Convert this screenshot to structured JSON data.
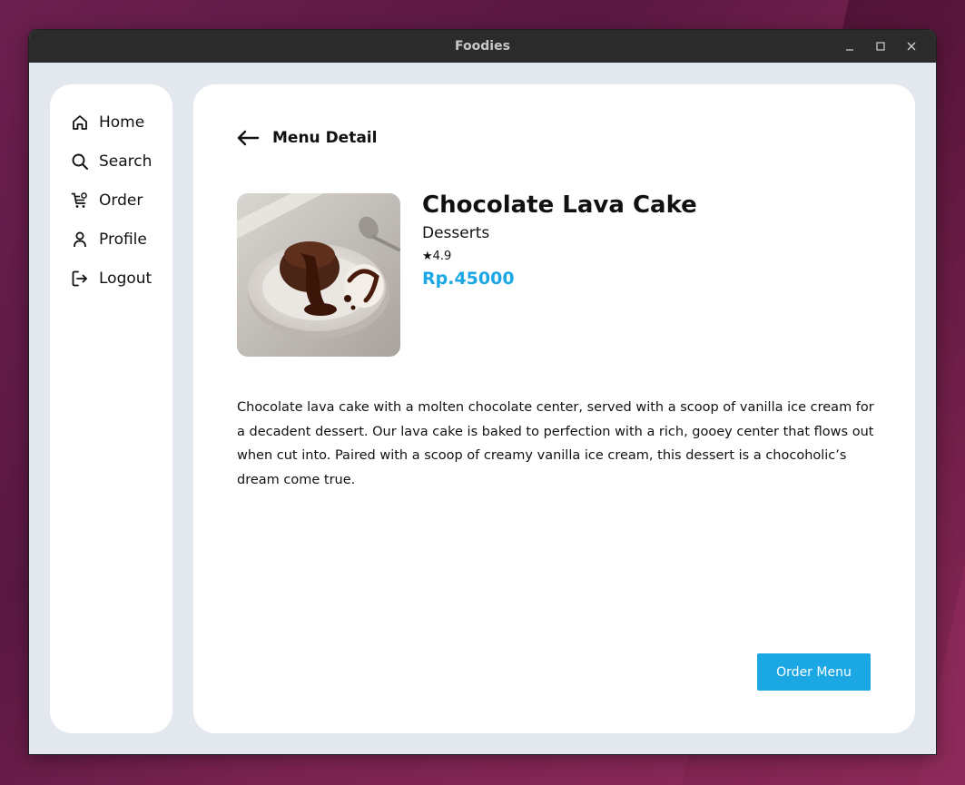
{
  "window": {
    "title": "Foodies"
  },
  "sidebar": {
    "items": [
      {
        "label": "Home",
        "icon": "home-icon"
      },
      {
        "label": "Search",
        "icon": "search-icon"
      },
      {
        "label": "Order",
        "icon": "cart-icon"
      },
      {
        "label": "Profile",
        "icon": "user-icon"
      },
      {
        "label": "Logout",
        "icon": "logout-icon"
      }
    ]
  },
  "main": {
    "title": "Menu Detail",
    "item": {
      "name": "Chocolate Lava Cake",
      "category": "Desserts",
      "rating": "★4.9",
      "price": "Rp.45000",
      "description": "Chocolate lava cake with a molten chocolate center, served with a scoop of vanilla ice cream for a decadent dessert. Our lava cake is baked to perfection with a rich, gooey center that flows out when cut into. Paired with a scoop of creamy vanilla ice cream, this dessert is a chocoholic’s dream come true."
    },
    "order_button": "Order Menu"
  },
  "colors": {
    "accent": "#1ba6e4",
    "app_bg": "#e3e8ef",
    "titlebar": "#2b2b2b"
  }
}
